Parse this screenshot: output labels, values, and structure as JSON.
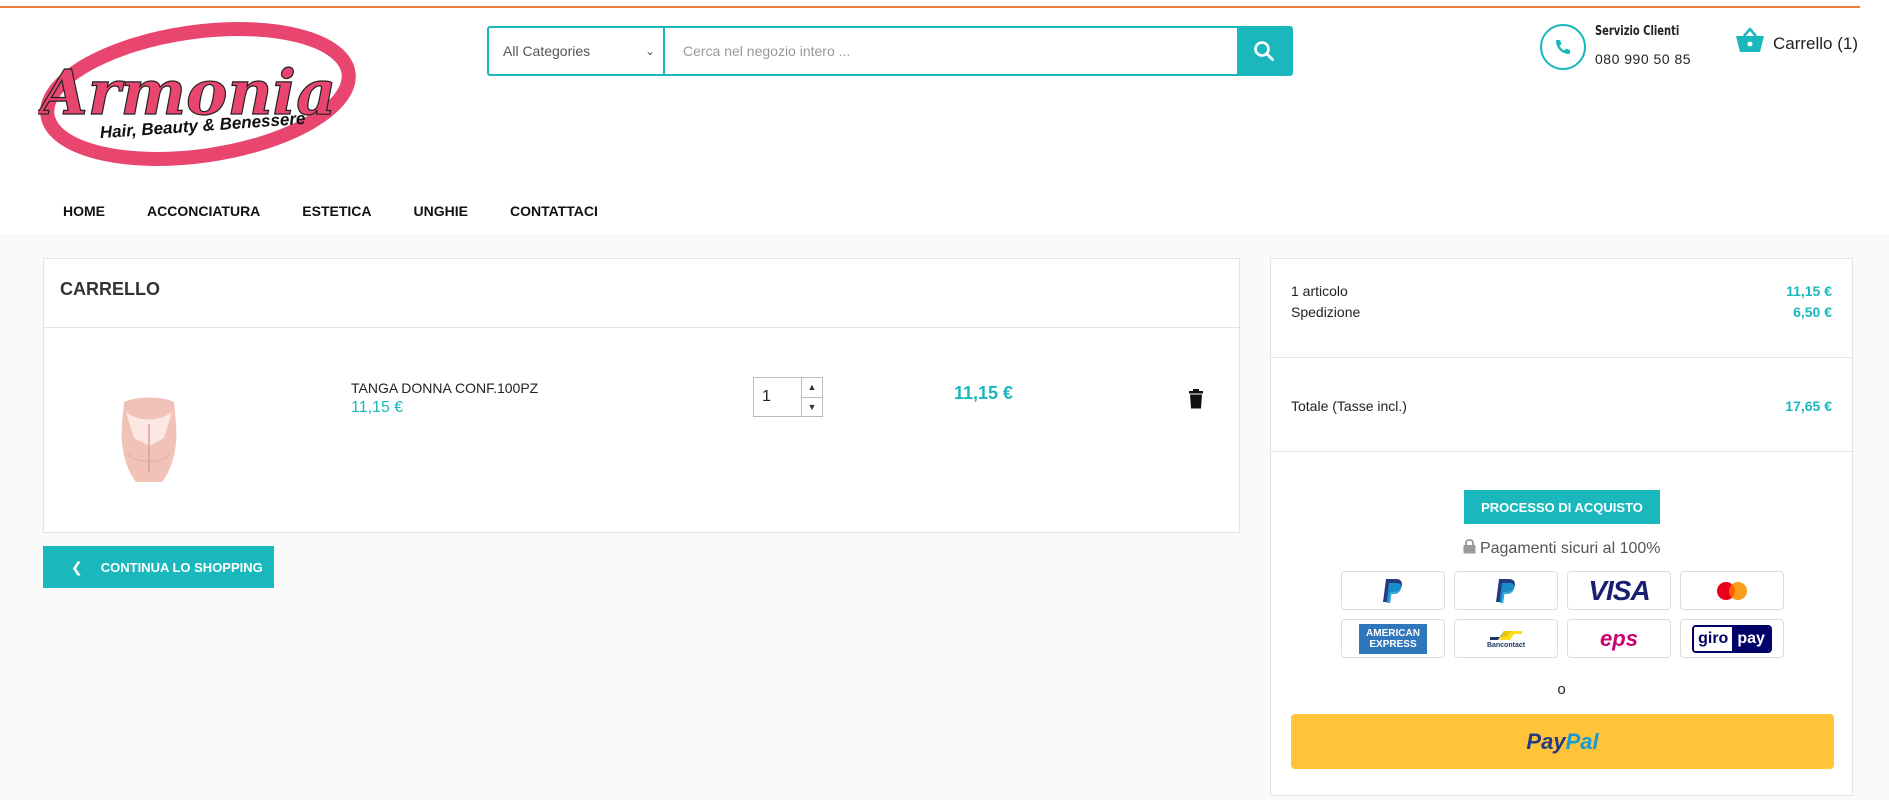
{
  "brand": {
    "logo_main": "Armonia",
    "logo_sub": "Hair, Beauty & Benessere",
    "primary_color": "#1ab8bd",
    "logo_color": "#e8466f"
  },
  "search": {
    "category": "All Categories",
    "placeholder": "Cerca nel negozio intero ..."
  },
  "service": {
    "title": "Servizio Clienti",
    "phone": "080 990 50 85"
  },
  "cart_link": {
    "label": "Carrello (1)"
  },
  "nav": {
    "items": [
      "HOME",
      "ACCONCIATURA",
      "ESTETICA",
      "UNGHIE",
      "CONTATTACI"
    ]
  },
  "cart": {
    "title": "CARRELLO",
    "item": {
      "name": "TANGA DONNA CONF.100PZ",
      "price": "11,15 €",
      "quantity": "1",
      "line_total": "11,15 €"
    },
    "continue_label": "CONTINUA LO SHOPPING"
  },
  "summary": {
    "items_label": "1 articolo",
    "items_value": "11,15 €",
    "shipping_label": "Spedizione",
    "shipping_value": "6,50 €",
    "total_label": "Totale (Tasse incl.)",
    "total_value": "17,65 €",
    "checkout_label": "PROCESSO DI ACQUISTO",
    "secure_label": "Pagamenti sicuri al 100%",
    "or_label": "o",
    "paypal_pay": "Pay",
    "paypal_pal": "Pal"
  },
  "payment_methods": {
    "visa": "VISA",
    "amex_1": "AMERICAN",
    "amex_2": "EXPRESS",
    "eps": "eps",
    "giro": "giro",
    "giro_pay": "pay",
    "bancontact": "Bancontact"
  }
}
